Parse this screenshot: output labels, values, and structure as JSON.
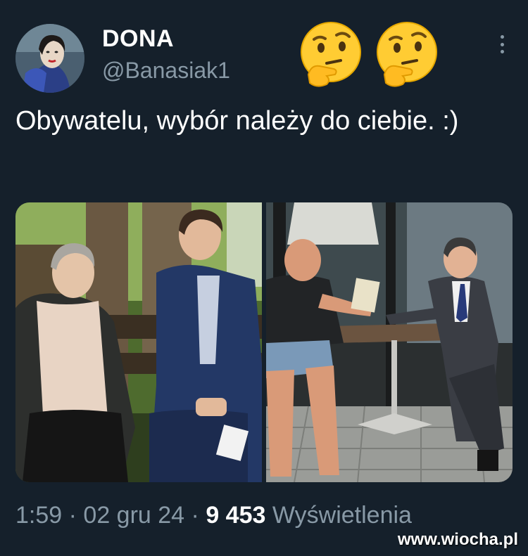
{
  "user": {
    "display_name": "DONA",
    "handle": "@Banasiak1",
    "avatar_icon": "portrait-avatar"
  },
  "header_emojis": [
    "thinking-face-icon",
    "thinking-face-icon"
  ],
  "tweet": {
    "text": "Obywatelu, wybór należy do ciebie. :)"
  },
  "media": {
    "photos": [
      {
        "description_icon": "photo-elderly-woman-and-man-on-bench"
      },
      {
        "description_icon": "photo-two-men-at-cafe-table"
      }
    ]
  },
  "meta": {
    "time": "1:59",
    "date": "02 gru 24",
    "views_count": "9 453",
    "views_label": "Wyświetlenia",
    "separator": "·"
  },
  "watermark": "www.wiocha.pl",
  "colors": {
    "background": "#15202b",
    "secondary_text": "#8899a6",
    "primary_text": "#ffffff"
  }
}
